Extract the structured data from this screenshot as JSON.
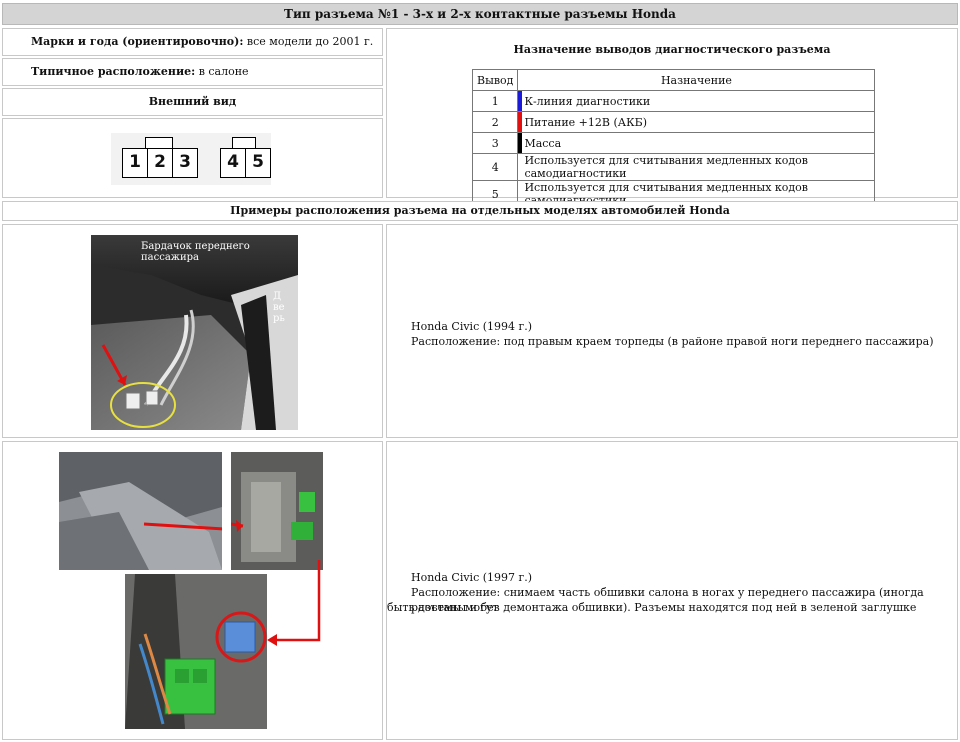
{
  "header": {
    "title": "Тип разъема №1 - 3-х и 2-х контактные разъемы Honda"
  },
  "info": {
    "brands_label": "Марки и года (ориентировочно):",
    "brands_value": "все модели до 2001 г.",
    "location_label": "Типичное расположение:",
    "location_value": "в салоне",
    "appearance_label": "Внешний вид"
  },
  "connector": {
    "block3": [
      "1",
      "2",
      "3"
    ],
    "block2": [
      "4",
      "5"
    ]
  },
  "pinout": {
    "title": "Назначение выводов диагностического разъема",
    "col_pin": "Вывод",
    "col_purpose": "Назначение",
    "rows": [
      {
        "pin": "1",
        "purpose": "К-линия диагностики",
        "color": "#1a1ad8"
      },
      {
        "pin": "2",
        "purpose": "Питание +12В (АКБ)",
        "color": "#e01010"
      },
      {
        "pin": "3",
        "purpose": "Масса",
        "color": "#000000"
      },
      {
        "pin": "4",
        "purpose": "Используется для считывания медленных кодов самодиагностики",
        "color": ""
      },
      {
        "pin": "5",
        "purpose": "Используется для считывания медленных кодов самодиагностики",
        "color": ""
      }
    ]
  },
  "examples": {
    "title": "Примеры расположения разъема на отдельных моделях автомобилей Honda",
    "civic1994": {
      "photo_label_glovebox": "Бардачок переднего пассажира",
      "photo_label_door": "Дверь",
      "model": "Honda Civic (1994 г.)",
      "location": "Расположение: под правым краем торпеды (в районе правой ноги переднего пассажира)"
    },
    "civic1997": {
      "model": "Honda Civic (1997 г.)",
      "location_line1": "Расположение: снимаем часть обшивки салона в ногах у переднего пассажира (иногда разъемы могут",
      "location_line2": "быть достаны и без демонтажа обшивки). Разъемы находятся под ней в зеленой заглушке"
    }
  }
}
